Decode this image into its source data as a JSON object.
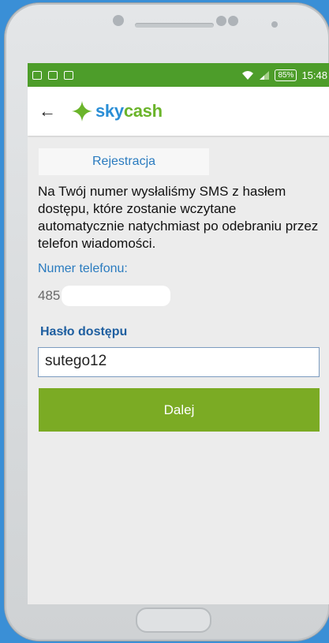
{
  "statusbar": {
    "battery": "85%",
    "time": "15:48"
  },
  "appbar": {
    "logo_sky": "sky",
    "logo_cash": "cash"
  },
  "tab": {
    "label": "Rejestracja"
  },
  "message": "Na Twój numer wysłaliśmy SMS z hasłem dostępu, które zostanie wczytane automatycznie natychmiast po odebraniu przez telefon wiadomości.",
  "phone": {
    "label": "Numer telefonu:",
    "prefix": "485"
  },
  "password": {
    "label": "Hasło dostępu",
    "value": "sutego12"
  },
  "submit_label": "Dalej",
  "colors": {
    "statusbar": "#4d9d2a",
    "accent_green": "#7bab24",
    "accent_blue": "#2a7bbf",
    "background": "#3a8fd6"
  }
}
